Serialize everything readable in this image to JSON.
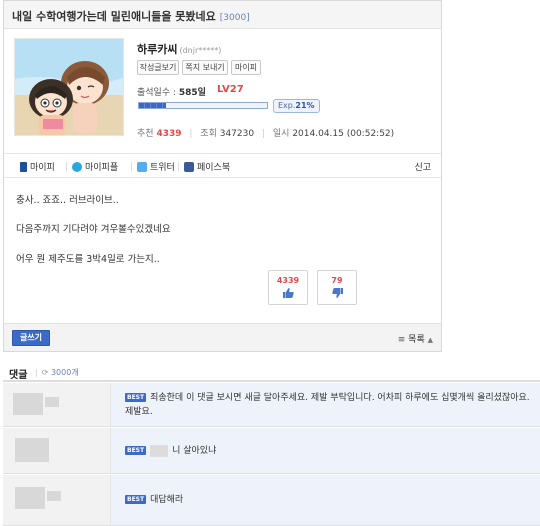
{
  "post": {
    "title": "내일 수학여행가는데 밀린애니들을 못봤네요",
    "comment_count_badge": "[3000]",
    "author": {
      "nickname": "하루카씨",
      "id_masked": "(dnjr*****)",
      "buttons": [
        "작성글보기",
        "쪽지 보내기",
        "마이피"
      ],
      "attendance_label": "출석일수 :",
      "attendance_value": "585일",
      "level": "LV27",
      "exp_label": "Exp.",
      "exp_percent": "21%",
      "exp_fraction": 0.21
    },
    "stats": {
      "recommend_label": "추천",
      "recommend_value": "4339",
      "views_label": "조회",
      "views_value": "347230",
      "date_label": "일시",
      "date_value": "2014.04.15 (00:52:52)"
    },
    "share": [
      {
        "label": "마이피",
        "icon": "mypi-icon",
        "color": "#1c4f9c"
      },
      {
        "label": "마이피플",
        "icon": "mypeople-icon",
        "color": "#29a8e0"
      },
      {
        "label": "트위터",
        "icon": "twitter-icon",
        "color": "#55acee"
      },
      {
        "label": "페이스북",
        "icon": "facebook-icon",
        "color": "#3b5998"
      }
    ],
    "report_label": "신고",
    "content": [
      "충사.. 죠죠.. 러브라이브..",
      "다음주까지 기다려야 겨우볼수있겠네요",
      "어우 뭔 제주도를 3박4일로 가는지.."
    ],
    "votes": {
      "up": "4339",
      "down": "79"
    },
    "write_label": "글쓰기",
    "list_label": "목록"
  },
  "comments": {
    "title": "댓글",
    "total": "3000개",
    "best_label": "BEST",
    "items": [
      {
        "text": "죄송한데 이 댓글 보시면 새글 달아주세요. 제발 부탁입니다. 어차피 하루에도 십몇개씩 올리셨잖아요. 제발요."
      },
      {
        "text": "니 살아있냐"
      },
      {
        "text": "대답해라"
      }
    ]
  },
  "colors": {
    "accent": "#3c6bc7",
    "level_red": "#e04a4a",
    "best_row_bg": "#eef3fb"
  }
}
